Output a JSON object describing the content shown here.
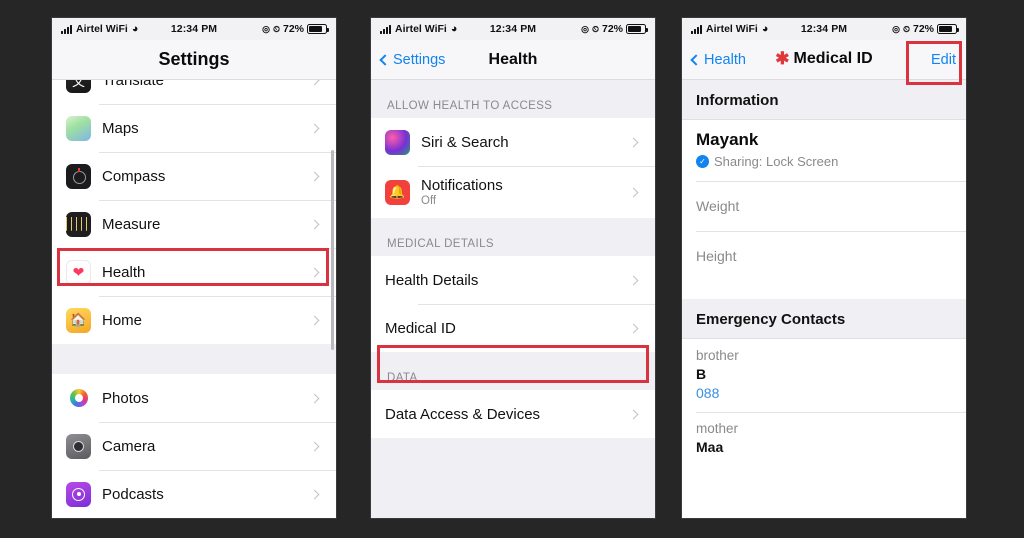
{
  "background_color": "#262626",
  "accent_blue": "#1184f0",
  "highlight_color": "#d9333f",
  "status_bar": {
    "carrier": "Airtel WiFi",
    "time": "12:34 PM",
    "battery_percent": "72%",
    "wifi_icon": "wifi-icon",
    "signal_icon": "signal-bars-icon",
    "location_icon": "location-services-icon",
    "alarm_icon": "alarm-icon",
    "battery_icon": "battery-icon"
  },
  "phone1": {
    "nav": {
      "title": "Settings"
    },
    "rows": [
      {
        "label": "Translate",
        "icon": "translate-app-icon",
        "icon_class": "ic-translate",
        "truncated": true
      },
      {
        "label": "Maps",
        "icon": "maps-app-icon",
        "icon_class": "ic-maps"
      },
      {
        "label": "Compass",
        "icon": "compass-app-icon",
        "icon_class": "ic-compass"
      },
      {
        "label": "Measure",
        "icon": "measure-app-icon",
        "icon_class": "ic-measure"
      },
      {
        "label": "Health",
        "icon": "health-app-icon",
        "icon_class": "ic-health",
        "highlighted": true
      },
      {
        "label": "Home",
        "icon": "home-app-icon",
        "icon_class": "ic-home"
      }
    ],
    "rows2": [
      {
        "label": "Photos",
        "icon": "photos-app-icon",
        "icon_class": "ic-photos"
      },
      {
        "label": "Camera",
        "icon": "camera-app-icon",
        "icon_class": "ic-camera"
      },
      {
        "label": "Podcasts",
        "icon": "podcasts-app-icon",
        "icon_class": "ic-podcasts"
      }
    ]
  },
  "phone2": {
    "nav": {
      "back": "Settings",
      "title": "Health"
    },
    "section1_header": "ALLOW HEALTH TO ACCESS",
    "section1_rows": [
      {
        "label": "Siri & Search",
        "sub": "",
        "icon": "siri-app-icon",
        "icon_class": "ic-siri"
      },
      {
        "label": "Notifications",
        "sub": "Off",
        "icon": "notifications-app-icon",
        "icon_class": "ic-notif"
      }
    ],
    "section2_header": "MEDICAL DETAILS",
    "section2_rows": [
      {
        "label": "Health Details"
      },
      {
        "label": "Medical ID",
        "highlighted": true
      }
    ],
    "section3_header": "DATA",
    "section3_rows": [
      {
        "label": "Data Access & Devices"
      }
    ]
  },
  "phone3": {
    "nav": {
      "back": "Health",
      "title": "Medical ID",
      "edit": "Edit",
      "medical_icon": "medical-asterisk-icon"
    },
    "information_header": "Information",
    "name": "Mayank",
    "sharing": "Sharing: Lock Screen",
    "sharing_icon": "check-circle-icon",
    "fields": [
      {
        "label": "Weight"
      },
      {
        "label": "Height"
      }
    ],
    "emergency_header": "Emergency Contacts",
    "contacts": [
      {
        "relation": "brother",
        "name": "B",
        "phone": "088"
      },
      {
        "relation": "mother",
        "name": "Maa",
        "phone": ""
      }
    ]
  }
}
